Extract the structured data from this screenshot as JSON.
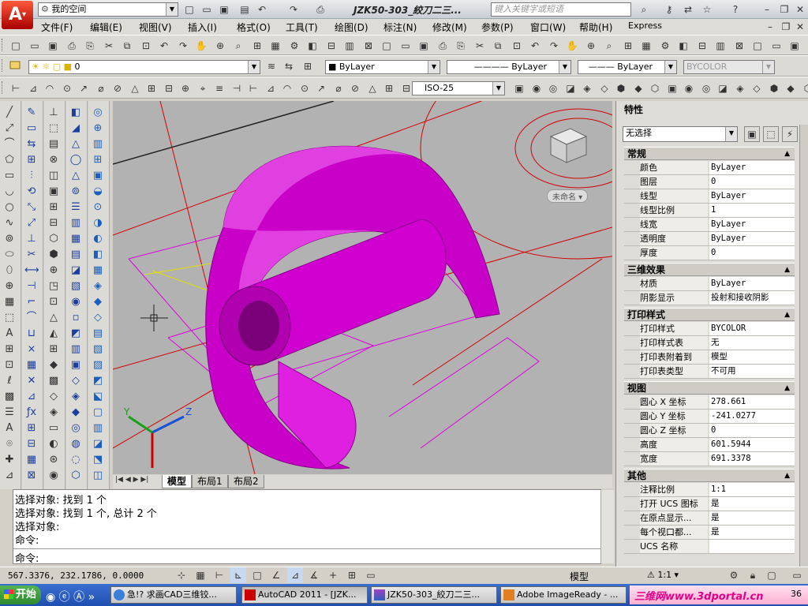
{
  "titlebar": {
    "workspace": "我的空间",
    "title": "JZK50-303_絞刀二三...",
    "search_placeholder": "键入关键字或短语"
  },
  "menu": [
    "文件(F)",
    "编辑(E)",
    "视图(V)",
    "插入(I)",
    "格式(O)",
    "工具(T)",
    "绘图(D)",
    "标注(N)",
    "修改(M)",
    "参数(P)",
    "窗口(W)",
    "帮助(H)",
    "Express"
  ],
  "layers": {
    "layer_value": "0",
    "color_value": "ByLayer",
    "linetype_value": "ByLayer",
    "lineweight_value": "ByLayer",
    "plotstyle_value": "BYCOLOR",
    "dimstyle_value": "ISO-25"
  },
  "viewcube": {
    "label": "未命名"
  },
  "layout_tabs": [
    "模型",
    "布局1",
    "布局2"
  ],
  "properties": {
    "title": "特性",
    "selection": "无选择",
    "sections": [
      {
        "name": "常规",
        "rows": [
          {
            "k": "颜色",
            "v": "ByLayer"
          },
          {
            "k": "图层",
            "v": "0"
          },
          {
            "k": "线型",
            "v": "ByLayer"
          },
          {
            "k": "线型比例",
            "v": "1"
          },
          {
            "k": "线宽",
            "v": "ByLayer"
          },
          {
            "k": "透明度",
            "v": "ByLayer"
          },
          {
            "k": "厚度",
            "v": "0"
          }
        ]
      },
      {
        "name": "三维效果",
        "rows": [
          {
            "k": "材质",
            "v": "ByLayer"
          },
          {
            "k": "阴影显示",
            "v": "投射和接收阴影"
          }
        ]
      },
      {
        "name": "打印样式",
        "rows": [
          {
            "k": "打印样式",
            "v": "BYCOLOR"
          },
          {
            "k": "打印样式表",
            "v": "无"
          },
          {
            "k": "打印表附着到",
            "v": "模型"
          },
          {
            "k": "打印表类型",
            "v": "不可用"
          }
        ]
      },
      {
        "name": "视图",
        "rows": [
          {
            "k": "圆心 X 坐标",
            "v": "278.661"
          },
          {
            "k": "圆心 Y 坐标",
            "v": "-241.0277"
          },
          {
            "k": "圆心 Z 坐标",
            "v": "0"
          },
          {
            "k": "高度",
            "v": "601.5944"
          },
          {
            "k": "宽度",
            "v": "691.3378"
          }
        ]
      },
      {
        "name": "其他",
        "rows": [
          {
            "k": "注释比例",
            "v": "1:1"
          },
          {
            "k": "打开 UCS 图标",
            "v": "是"
          },
          {
            "k": "在原点显示...",
            "v": "是"
          },
          {
            "k": "每个视口都...",
            "v": "是"
          },
          {
            "k": "UCS 名称",
            "v": ""
          }
        ]
      }
    ]
  },
  "command": {
    "lines": [
      "选择对象: 找到 1 个",
      "选择对象: 找到 1 个, 总计 2 个",
      "选择对象:",
      "命令:"
    ],
    "prompt": "命令:"
  },
  "status": {
    "coords": "567.3376, 232.1786, 0.0000",
    "model": "模型",
    "scale": "1:1"
  },
  "taskbar": {
    "start": "开始",
    "tasks": [
      "急!? 求画CAD三维铰...",
      "AutoCAD 2011 - [JZK...",
      "JZK50-303_絞刀二三...",
      "Adobe ImageReady - ..."
    ],
    "watermark": "三维网www.3dportal.cn",
    "clock": "36"
  },
  "colors": {
    "accent": "#e000e0",
    "drawing_bg": "#b2b2b2",
    "red_lines": "#d40000"
  }
}
